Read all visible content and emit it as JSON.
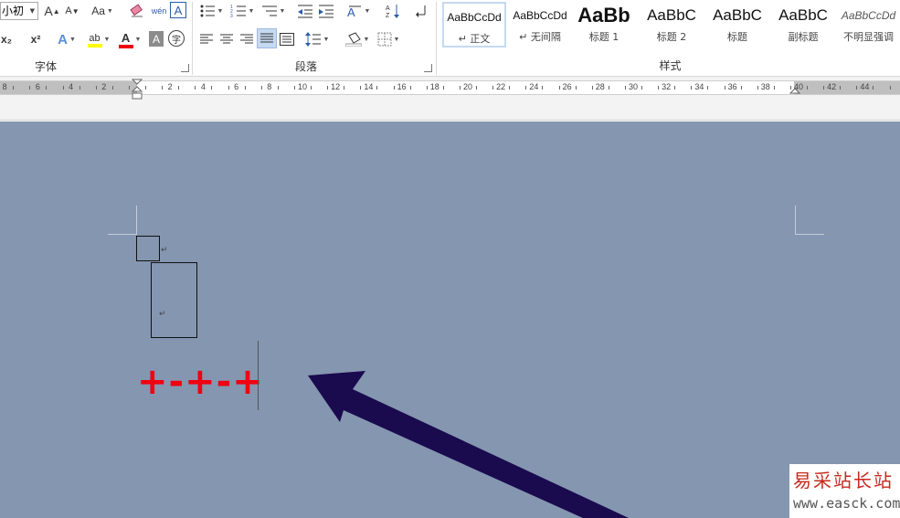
{
  "ribbon": {
    "font_group": {
      "label": "字体",
      "font_size": "小初",
      "grow_font": "A",
      "shrink_font": "A",
      "change_case": "Aa",
      "phonetic_guide": "wén",
      "character_border": "A",
      "subscript": "x₂",
      "superscript": "x²",
      "text_effects": "A",
      "highlight": "ab",
      "font_color": "A",
      "character_shading": "A",
      "enclose_char": "字"
    },
    "paragraph_group": {
      "label": "段落"
    },
    "styles_group": {
      "label": "样式",
      "items": [
        {
          "sample": "AaBbCcDd",
          "name": "↵ 正文"
        },
        {
          "sample": "AaBbCcDd",
          "name": "↵ 无间隔"
        },
        {
          "sample": "AaBb",
          "name": "标题 1"
        },
        {
          "sample": "AaBbC",
          "name": "标题 2"
        },
        {
          "sample": "AaBbC",
          "name": "标题"
        },
        {
          "sample": "AaBbC",
          "name": "副标题"
        },
        {
          "sample": "AaBbCcDd",
          "name": "不明显强调"
        }
      ]
    }
  },
  "ruler": {
    "left_labels": [
      "8",
      "6",
      "4",
      "2"
    ],
    "right_labels": [
      "2",
      "4",
      "6",
      "8",
      "10",
      "12",
      "14",
      "16",
      "18",
      "20",
      "22",
      "24",
      "26",
      "28",
      "30",
      "32",
      "34",
      "36",
      "38",
      "40",
      "42",
      "44"
    ]
  },
  "document": {
    "formula_text": "+-+-+"
  },
  "watermark": {
    "title": "易采站长站",
    "url": "www.easck.com"
  },
  "colors": {
    "page_background": "#8496b0",
    "formula_color": "#f00010",
    "arrow_color": "#1a0a4e",
    "selected_button": "#c5d9f1"
  }
}
